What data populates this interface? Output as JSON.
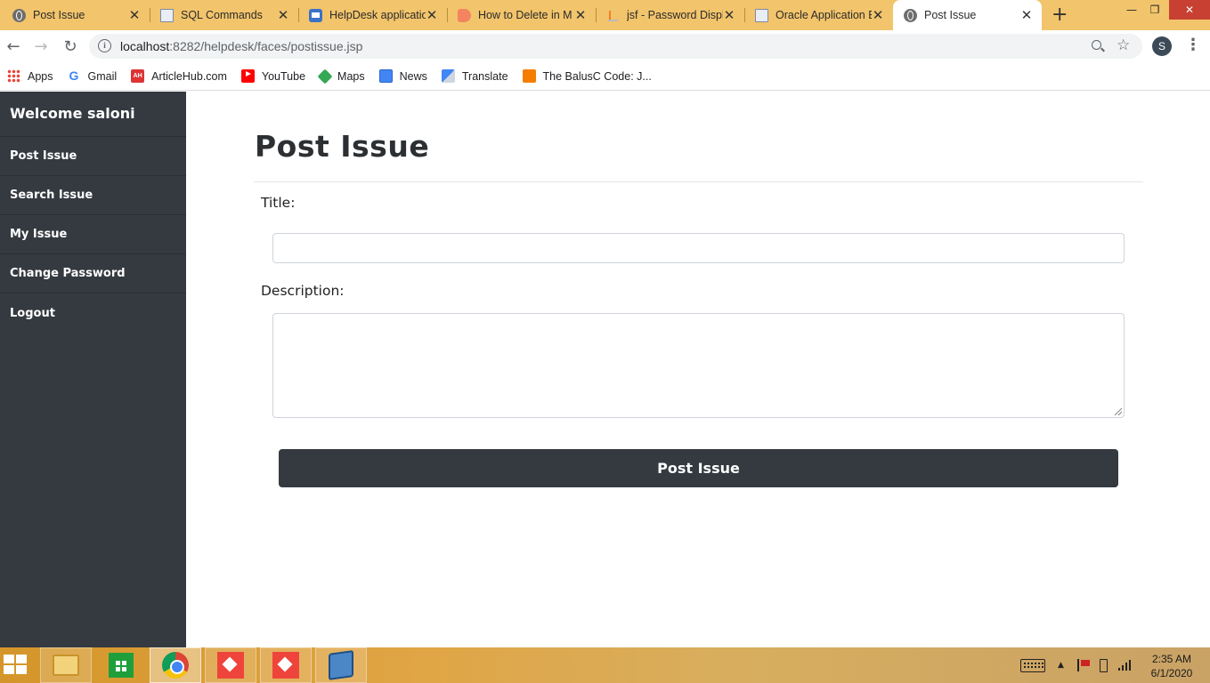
{
  "browser": {
    "tabs": [
      {
        "title": "Post Issue",
        "favicon": "globe-icon"
      },
      {
        "title": "SQL Commands",
        "favicon": "document-icon"
      },
      {
        "title": "HelpDesk applicatio",
        "favicon": "helpdesk-icon"
      },
      {
        "title": "How to Delete in M",
        "favicon": "chat-icon"
      },
      {
        "title": "jsf - Password Displ",
        "favicon": "stackoverflow-icon"
      },
      {
        "title": "Oracle Application E",
        "favicon": "document-icon"
      },
      {
        "title": "Post Issue",
        "favicon": "globe-icon",
        "active": true
      }
    ],
    "new_tab_label": "+",
    "url_host": "localhost",
    "url_rest": ":8282/helpdesk/faces/postissue.jsp",
    "profile_initial": "S",
    "bookmarks": [
      {
        "label": "Apps",
        "icon": "apps-grid-icon"
      },
      {
        "label": "Gmail",
        "icon": "google-icon"
      },
      {
        "label": "ArticleHub.com",
        "icon": "articlehub-icon"
      },
      {
        "label": "YouTube",
        "icon": "youtube-icon"
      },
      {
        "label": "Maps",
        "icon": "maps-pin-icon"
      },
      {
        "label": "News",
        "icon": "news-icon"
      },
      {
        "label": "Translate",
        "icon": "translate-icon"
      },
      {
        "label": "The BalusC Code: J...",
        "icon": "blogger-icon"
      }
    ]
  },
  "sidebar": {
    "welcome": "Welcome saloni",
    "items": [
      {
        "label": "Post Issue"
      },
      {
        "label": "Search Issue"
      },
      {
        "label": "My Issue"
      },
      {
        "label": "Change Password"
      },
      {
        "label": "Logout"
      }
    ],
    "background": "#343a40"
  },
  "main": {
    "title": "Post Issue",
    "title_label": "Title:",
    "title_value": "",
    "description_label": "Description:",
    "description_value": "",
    "submit_label": "Post Issue"
  },
  "taskbar": {
    "apps": [
      "file-explorer-icon",
      "store-icon",
      "chrome-icon",
      "anydesk-icon",
      "anydesk-icon",
      "virtualbox-icon"
    ],
    "time": "2:35 AM",
    "date": "6/1/2020"
  }
}
